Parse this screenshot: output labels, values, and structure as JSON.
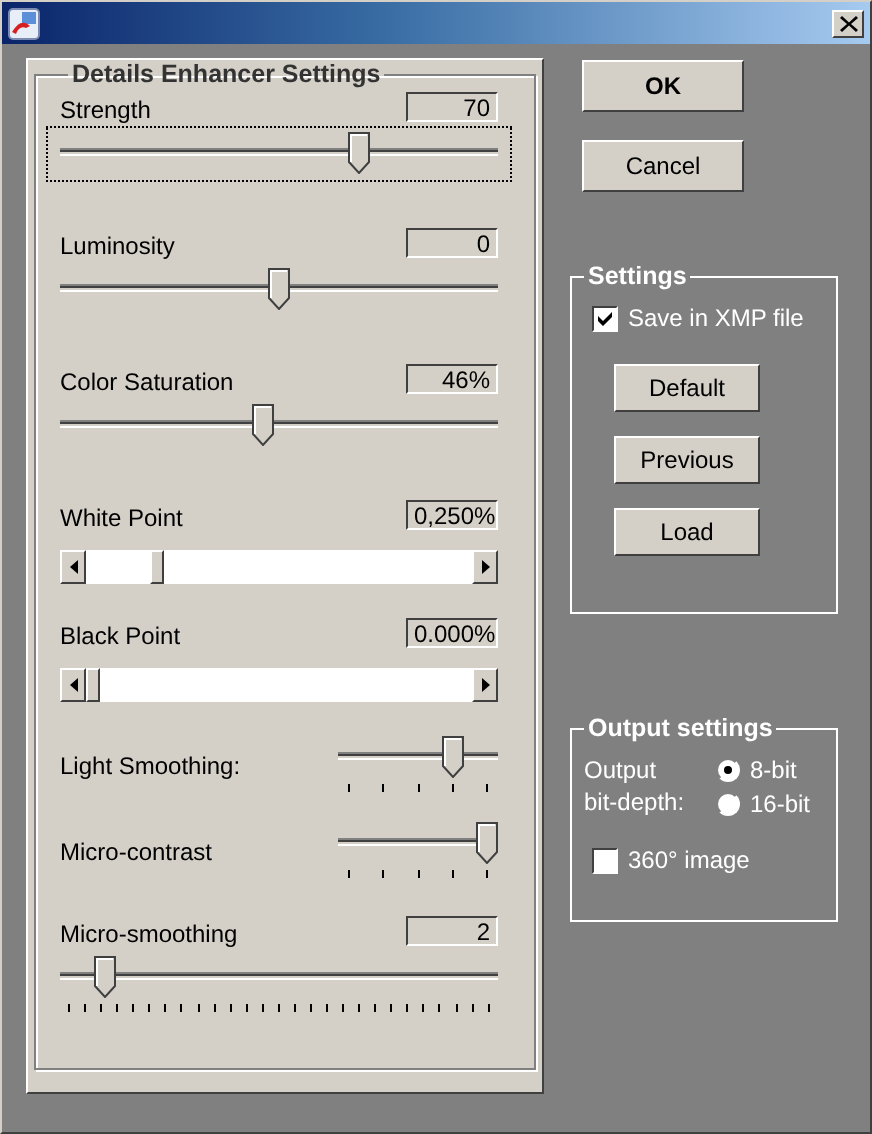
{
  "details_group": {
    "title": "Details Enhancer Settings",
    "controls": [
      {
        "kind": "slider",
        "label": "Strength",
        "value": "70",
        "level": 0.69,
        "focused": true
      },
      {
        "kind": "slider",
        "label": "Luminosity",
        "value": "0",
        "level": 0.5,
        "focused": false
      },
      {
        "kind": "slider",
        "label": "Color Saturation",
        "value": "46%",
        "level": 0.46,
        "focused": false
      },
      {
        "kind": "scrollbar",
        "label": "White Point",
        "value": "0,250%",
        "focused": false
      },
      {
        "kind": "scrollbar",
        "label": "Black Point",
        "value": "0.000%",
        "focused": false
      },
      {
        "kind": "ticked",
        "label": "Light Smoothing:",
        "level": 0.75,
        "focused": false
      },
      {
        "kind": "ticked",
        "label": "Micro-contrast",
        "level": 1,
        "focused": false
      },
      {
        "kind": "fine",
        "label": "Micro-smoothing",
        "value": "2",
        "level": 0.08,
        "focused": false
      }
    ]
  },
  "buttons": [
    {
      "label": "OK",
      "default": true
    },
    {
      "label": "Cancel",
      "default": false
    }
  ],
  "settings_group": {
    "title": "Settings",
    "save_in_xmp": {
      "label": "Save in XMP file",
      "checked": true
    },
    "buttons": [
      "Default",
      "Previous",
      "Load"
    ]
  },
  "output_group": {
    "title": "Output settings",
    "bit_depth_label": "Output\nbit-depth:",
    "bit_depth_options": [
      {
        "label": "8-bit",
        "selected": true
      },
      {
        "label": "16-bit",
        "selected": false
      }
    ],
    "image_360": {
      "label": "360° image",
      "checked": false
    }
  }
}
